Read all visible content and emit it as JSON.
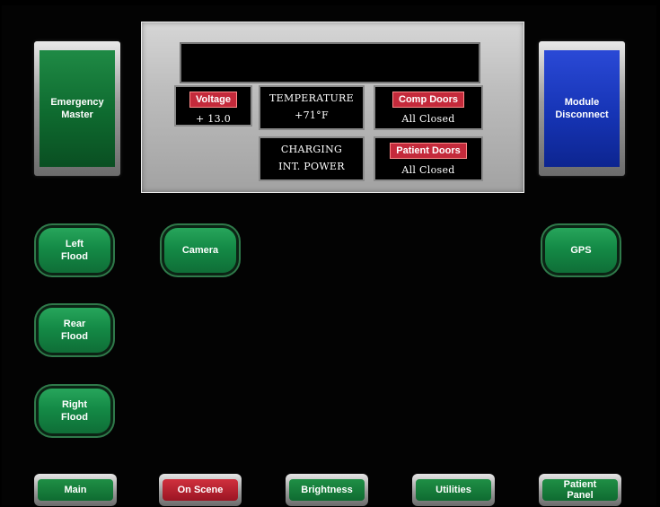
{
  "left_panel": {
    "emergency_master": "Emergency\nMaster",
    "flood_buttons": [
      "Left\nFlood",
      "Rear\nFlood",
      "Right\nFlood"
    ]
  },
  "right_panel": {
    "module_disconnect": "Module\nDisconnect",
    "gps": "GPS"
  },
  "center": {
    "camera": "Camera"
  },
  "status": {
    "voltage_label": "Voltage",
    "voltage_value": "+ 13.0",
    "temperature_label": "TEMPERATURE",
    "temperature_value": "+71°F",
    "charging_label": "CHARGING",
    "charging_value": "INT. POWER",
    "comp_doors_label": "Comp Doors",
    "comp_doors_value": "All Closed",
    "patient_doors_label": "Patient Doors",
    "patient_doors_value": "All Closed"
  },
  "nav": {
    "main": "Main",
    "on_scene": "On Scene",
    "brightness": "Brightness",
    "utilities": "Utilities",
    "patient_panel": "Patient\nPanel"
  },
  "colors": {
    "green": "#148a46",
    "blue": "#1634b5",
    "red": "#c42a3b"
  }
}
